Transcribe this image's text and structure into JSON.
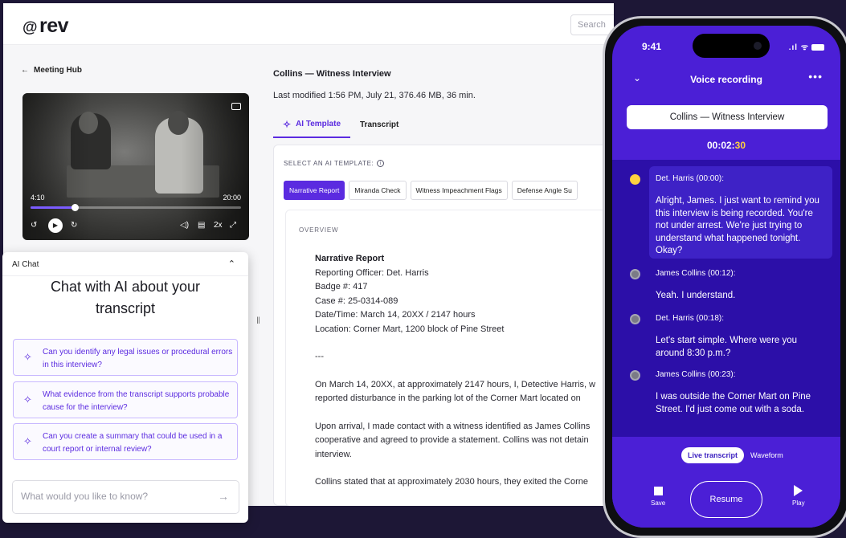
{
  "app": {
    "logo_at": "@",
    "logo_text": "rev",
    "search_placeholder": "Search"
  },
  "nav": {
    "back_arrow": "←",
    "back_label": "Meeting Hub"
  },
  "video": {
    "time_current": "4:10",
    "time_total": "20:00",
    "progress_fraction": 0.21,
    "controls": {
      "rewind": "↺",
      "play": "▶",
      "forward": "↻",
      "volume": "◁)",
      "captions": "▤",
      "speed": "2x",
      "fullscreen": "⤢"
    }
  },
  "document": {
    "title": "Collins — Witness Interview",
    "meta": "Last modified 1:56 PM, July 21, 376.46 MB, 36 min.",
    "tabs": [
      {
        "label": "AI Template",
        "active": true
      },
      {
        "label": "Transcript",
        "active": false
      }
    ],
    "template_label": "SELECT AN AI TEMPLATE:",
    "template_chips": [
      "Narrative Report",
      "Miranda Check",
      "Witness Impeachment Flags",
      "Defense Angle Su"
    ],
    "overview_label": "OVERVIEW",
    "report": {
      "heading": "Narrative Report",
      "officer": "Reporting Officer: Det. Harris",
      "badge": "Badge #: 417",
      "case": "Case #: 25-0314-089",
      "datetime": "Date/Time: March 14, 20XX / 2147 hours",
      "location": "Location: Corner Mart, 1200 block of Pine Street",
      "separator": "---",
      "p1_l1": "On March 14, 20XX, at approximately 2147 hours, I, Detective Harris, w",
      "p1_l2": "reported disturbance in the parking lot of the Corner Mart located on",
      "p2_l1": "Upon arrival, I made contact with a witness identified as James Collins",
      "p2_l2": "cooperative and agreed to provide a statement. Collins was not detain",
      "p2_l3": "interview.",
      "p3_l1": "Collins stated that at approximately 2030 hours, they exited the Corne"
    }
  },
  "chat": {
    "header": "AI Chat",
    "collapse_icon": "⌃",
    "title": "Chat with AI about your transcript",
    "suggestions": [
      "Can you identify any legal issues or procedural errors in this interview?",
      "What evidence from the transcript supports probable cause for the interview?",
      "Can you create a summary that could be used in a court report or internal review?"
    ],
    "input_placeholder": "What would you like to know?",
    "send_icon": "→"
  },
  "phone": {
    "status_time": "9:41",
    "status_icons": ".ıl ᯤ",
    "back_icon": "⌄",
    "title": "Voice recording",
    "more_icon": "•••",
    "recording_name": "Collins — Witness Interview",
    "timer_prefix": "00:02:",
    "timer_seconds": "30",
    "transcript": [
      {
        "speaker": "Det. Harris (00:00):",
        "text": "Alright, James. I just want to remind you this interview is being recorded. You're not under arrest. We're just trying to understand what happened tonight. Okay?",
        "active": true
      },
      {
        "speaker": "James Collins (00:12):",
        "text": "Yeah. I understand.",
        "active": false
      },
      {
        "speaker": "Det. Harris (00:18):",
        "text": "Let's start simple. Where were you around 8:30 p.m.?",
        "active": false
      },
      {
        "speaker": "James Collins (00:23):",
        "text": "I was outside the Corner Mart on Pine Street. I'd just come out with a soda.",
        "active": false
      }
    ],
    "toggle_on": "Live transcript",
    "toggle_off": "Waveform",
    "save_label": "Save",
    "resume_label": "Resume",
    "play_label": "Play"
  }
}
